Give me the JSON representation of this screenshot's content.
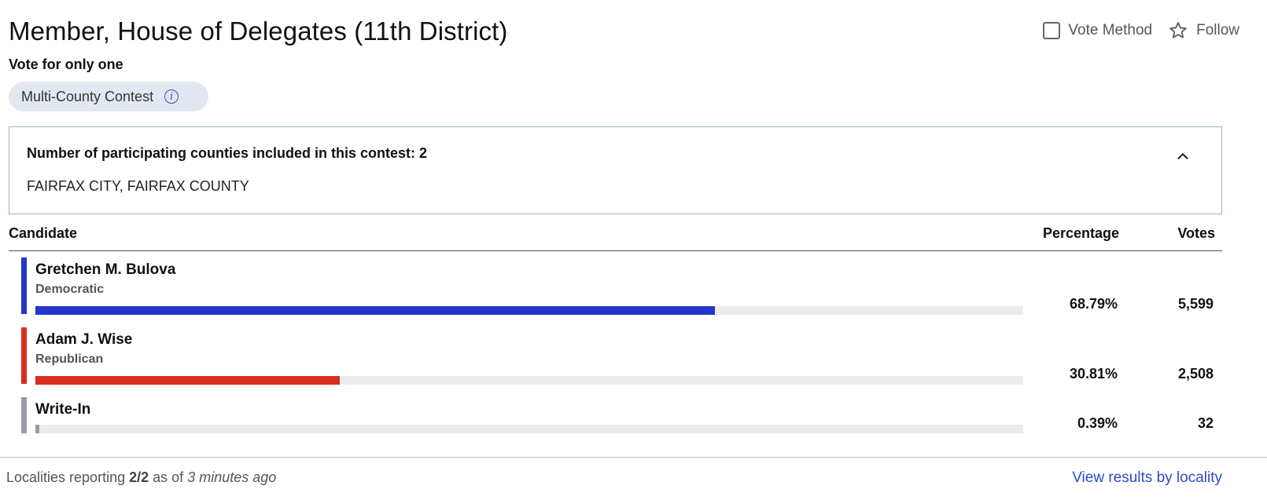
{
  "contest": {
    "title": "Member, House of Delegates (11th District)",
    "subtitle": "Vote for only one",
    "chip_label": "Multi-County Contest"
  },
  "toolbar": {
    "vote_method_label": "Vote Method",
    "follow_label": "Follow"
  },
  "counties_panel": {
    "heading": "Number of participating counties included in this contest: 2",
    "counties": "FAIRFAX CITY, FAIRFAX COUNTY"
  },
  "table": {
    "headers": {
      "candidate": "Candidate",
      "percentage": "Percentage",
      "votes": "Votes"
    },
    "rows": [
      {
        "name": "Gretchen M. Bulova",
        "party": "Democratic",
        "percentage": "68.79%",
        "votes": "5,599",
        "share": 0.6879,
        "color": "#2336c8"
      },
      {
        "name": "Adam J. Wise",
        "party": "Republican",
        "percentage": "30.81%",
        "votes": "2,508",
        "share": 0.3081,
        "color": "#d92e20"
      },
      {
        "name": "Write-In",
        "party": "",
        "percentage": "0.39%",
        "votes": "32",
        "share": 0.0039,
        "color": "#9a9ca3"
      }
    ]
  },
  "footer": {
    "reporting_prefix": "Localities reporting",
    "reporting_count": "2/2",
    "reporting_mid": "as of",
    "reporting_time": "3 minutes ago",
    "link_label": "View results by locality"
  },
  "colors": {
    "accent": "#2d4bc6"
  }
}
